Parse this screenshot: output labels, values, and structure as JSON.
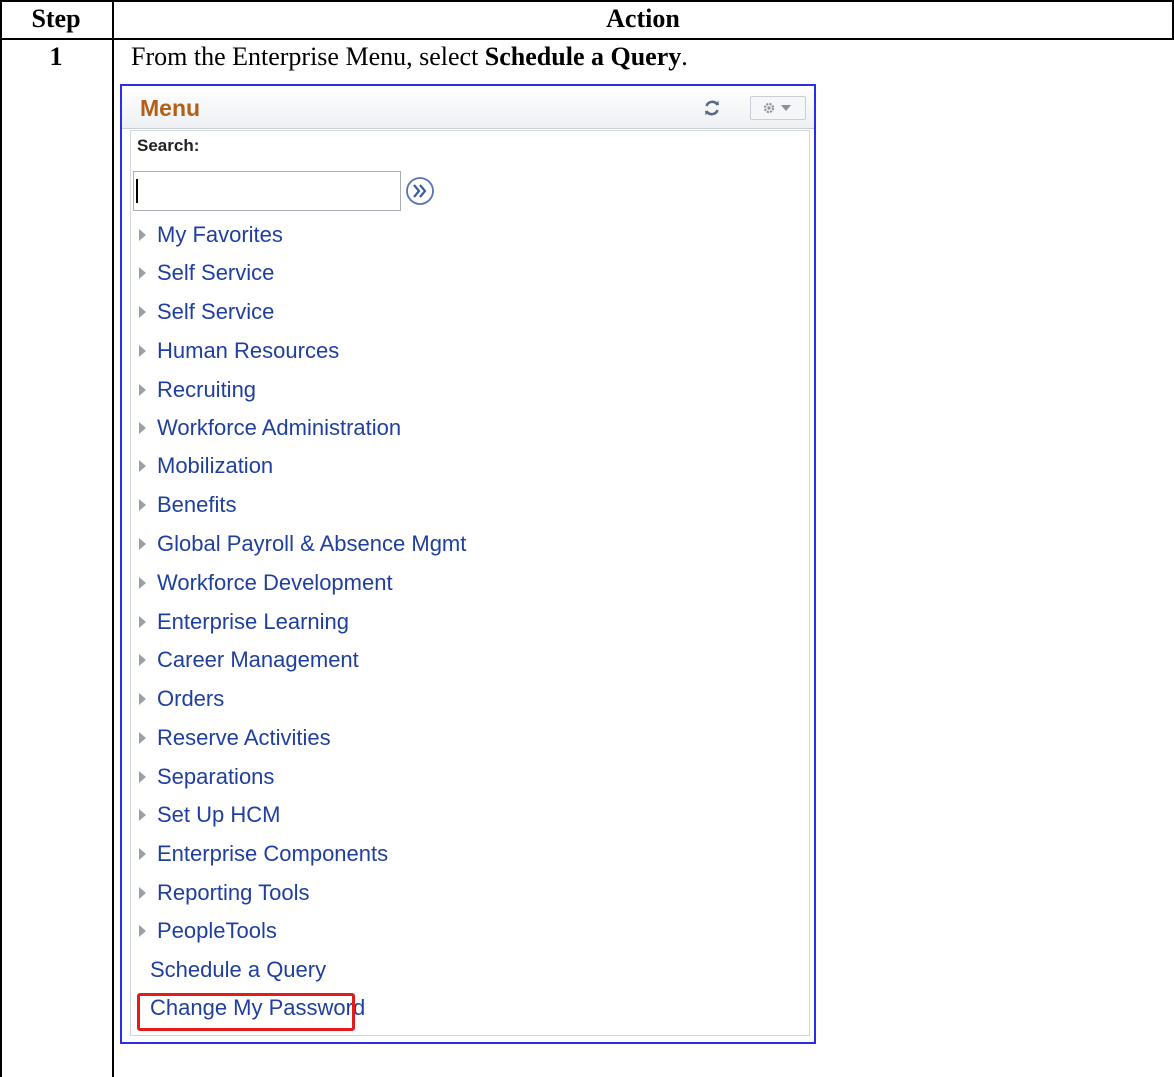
{
  "table": {
    "header_step": "Step",
    "header_action": "Action"
  },
  "row": {
    "step": "1",
    "instruction_prefix": "From the Enterprise Menu, select ",
    "instruction_bold": "Schedule a Query",
    "instruction_suffix": "."
  },
  "menu": {
    "title": "Menu",
    "search_label": "Search:",
    "search_value": "",
    "items": [
      {
        "label": "My Favorites",
        "expandable": true
      },
      {
        "label": "Self Service",
        "expandable": true
      },
      {
        "label": "Self Service",
        "expandable": true
      },
      {
        "label": "Human Resources",
        "expandable": true
      },
      {
        "label": "Recruiting",
        "expandable": true
      },
      {
        "label": "Workforce Administration",
        "expandable": true
      },
      {
        "label": "Mobilization",
        "expandable": true
      },
      {
        "label": "Benefits",
        "expandable": true
      },
      {
        "label": "Global Payroll & Absence Mgmt",
        "expandable": true
      },
      {
        "label": "Workforce Development",
        "expandable": true
      },
      {
        "label": "Enterprise Learning",
        "expandable": true
      },
      {
        "label": "Career Management",
        "expandable": true
      },
      {
        "label": "Orders",
        "expandable": true
      },
      {
        "label": "Reserve Activities",
        "expandable": true
      },
      {
        "label": "Separations",
        "expandable": true
      },
      {
        "label": "Set Up HCM",
        "expandable": true
      },
      {
        "label": "Enterprise Components",
        "expandable": true
      },
      {
        "label": "Reporting Tools",
        "expandable": true
      },
      {
        "label": "PeopleTools",
        "expandable": true
      },
      {
        "label": "Schedule a Query",
        "expandable": false,
        "highlighted": true
      },
      {
        "label": "Change My Password",
        "expandable": false
      }
    ],
    "colors": {
      "title": "#b35f17",
      "link": "#1f3f9e",
      "border": "#2a2ee6",
      "highlight": "#e21b1b"
    },
    "icons": [
      "refresh-icon",
      "gear-icon",
      "chevron-down-icon",
      "double-chevron-right-icon",
      "triangle-right-icon"
    ]
  }
}
